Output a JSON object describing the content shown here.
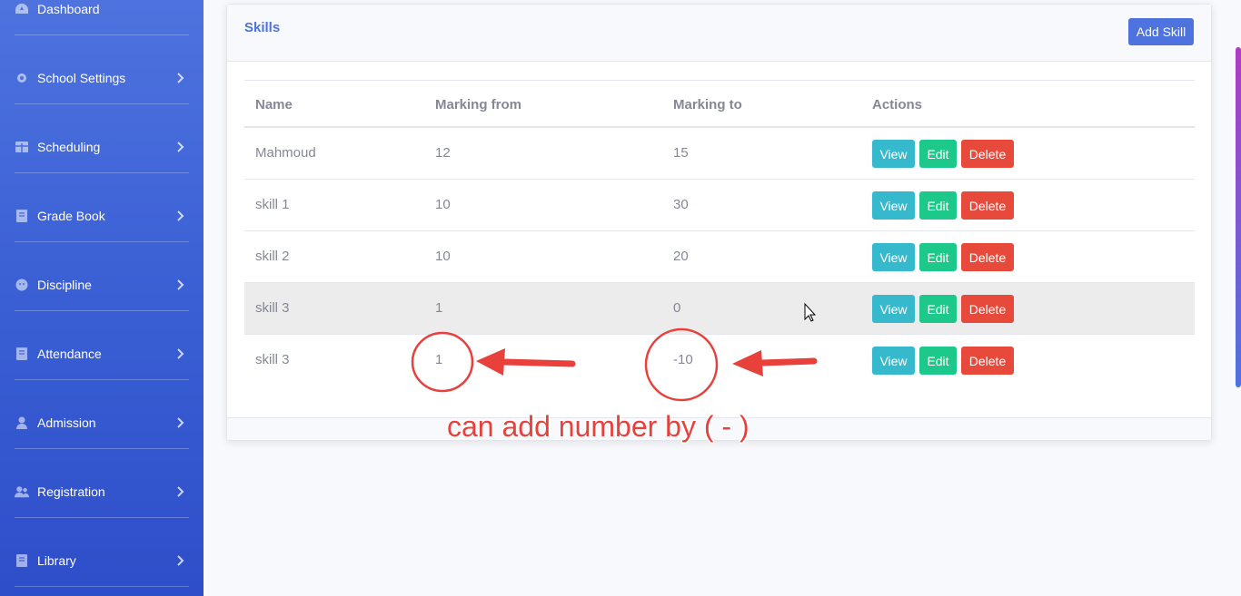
{
  "sidebar": {
    "items": [
      {
        "label": "Dashboard",
        "icon": "dashboard-icon",
        "has_chevron": false
      },
      {
        "label": "School Settings",
        "icon": "gear-icon",
        "has_chevron": true
      },
      {
        "label": "Scheduling",
        "icon": "table-icon",
        "has_chevron": true
      },
      {
        "label": "Grade Book",
        "icon": "book-icon",
        "has_chevron": true
      },
      {
        "label": "Discipline",
        "icon": "face-icon",
        "has_chevron": true
      },
      {
        "label": "Attendance",
        "icon": "book-icon",
        "has_chevron": true
      },
      {
        "label": "Admission",
        "icon": "user-icon",
        "has_chevron": true
      },
      {
        "label": "Registration",
        "icon": "users-icon",
        "has_chevron": true
      },
      {
        "label": "Library",
        "icon": "book-icon",
        "has_chevron": true
      }
    ]
  },
  "card": {
    "title": "Skills",
    "add_button": "Add Skill"
  },
  "table": {
    "headers": [
      "Name",
      "Marking from",
      "Marking to",
      "Actions"
    ],
    "rows": [
      {
        "name": "Mahmoud",
        "from": "12",
        "to": "15"
      },
      {
        "name": "skill 1",
        "from": "10",
        "to": "30"
      },
      {
        "name": "skill 2",
        "from": "10",
        "to": "20"
      },
      {
        "name": "skill 3",
        "from": "1",
        "to": "0"
      },
      {
        "name": "skill 3",
        "from": "1",
        "to": "-10"
      }
    ],
    "action_labels": {
      "view": "View",
      "edit": "Edit",
      "delete": "Delete"
    }
  },
  "annotation": {
    "text": "can add number by (  -  )"
  },
  "colors": {
    "primary": "#4e73df",
    "info": "#36b9cc",
    "success": "#1cc88a",
    "danger": "#e74a3b",
    "annotation": "#e8403a"
  }
}
